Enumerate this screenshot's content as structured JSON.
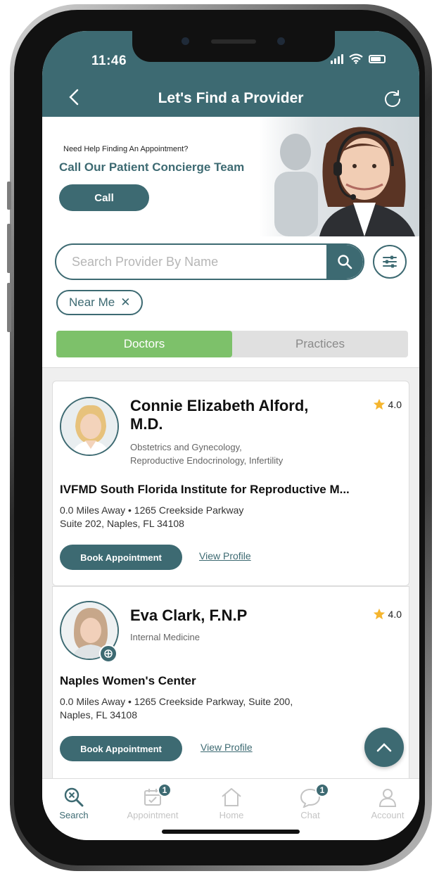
{
  "status_bar": {
    "time": "11:46"
  },
  "header": {
    "title": "Let's Find a Provider"
  },
  "banner": {
    "small_text": "Need Help Finding An Appointment?",
    "big_text": "Call Our Patient Concierge Team",
    "call_label": "Call"
  },
  "search": {
    "placeholder": "Search Provider By Name",
    "value": ""
  },
  "filter_chip": {
    "label": "Near Me",
    "remove_icon": "✕"
  },
  "segment": {
    "doctors": "Doctors",
    "practices": "Practices",
    "selected": "Doctors"
  },
  "providers": [
    {
      "name_line1": "Connie Elizabeth Alford,",
      "name_line2": "M.D.",
      "rating": "4.0",
      "specialty_line1": "Obstetrics and Gynecology,",
      "specialty_line2": "Reproductive Endocrinology, Infertility",
      "practice": "IVFMD South Florida Institute for Reproductive M...",
      "address_line1": "0.0 Miles Away • 1265 Creekside Parkway",
      "address_line2": "Suite 202, Naples, FL 34108",
      "book_label": "Book Appointment",
      "profile_label": "View Profile"
    },
    {
      "name_line1": "Eva  Clark, F.N.P",
      "rating": "4.0",
      "specialty_line1": "Internal Medicine",
      "practice": "Naples Women's Center",
      "address_line1": "0.0 Miles Away • 1265 Creekside Parkway, Suite 200,",
      "address_line2": "Naples, FL 34108",
      "book_label": "Book Appointment",
      "profile_label": "View Profile"
    }
  ],
  "tabbar": {
    "items": [
      {
        "label": "Search",
        "icon": "search-icon",
        "active": true
      },
      {
        "label": "Appointment",
        "icon": "calendar-icon",
        "badge": "1"
      },
      {
        "label": "Home",
        "icon": "home-icon"
      },
      {
        "label": "Chat",
        "icon": "chat-icon",
        "badge": "1"
      },
      {
        "label": "Account",
        "icon": "user-icon"
      }
    ]
  },
  "colors": {
    "primary": "#3d6a72",
    "accent_green": "#7dc16a",
    "star": "#f5b52e"
  }
}
